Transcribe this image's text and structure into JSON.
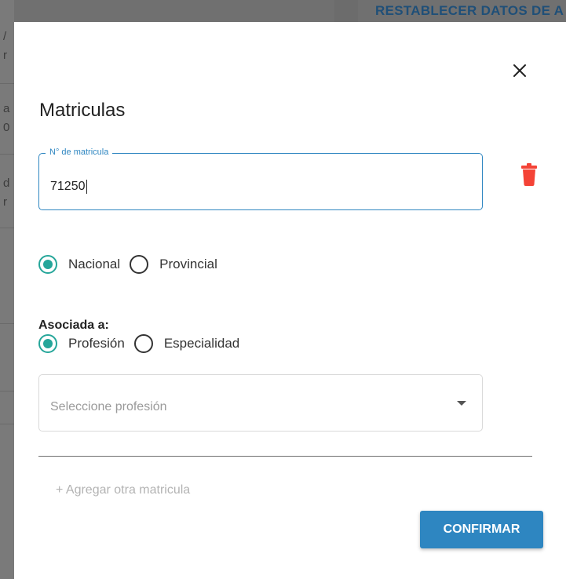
{
  "background": {
    "reset_button_label": "RESTABLECER DATOS DE A",
    "left_chars": [
      "/",
      "r",
      "a",
      "0",
      "d",
      "r"
    ]
  },
  "dialog": {
    "title": "Matriculas",
    "close_icon": "close-icon",
    "matricula_field": {
      "label": "N° de matricula",
      "value": "71250"
    },
    "delete_icon": "trash-icon",
    "delete_color": "#f44336",
    "jurisdiction_options": [
      {
        "label": "Nacional",
        "checked": true
      },
      {
        "label": "Provincial",
        "checked": false
      }
    ],
    "associated_label": "Asociada a:",
    "association_options": [
      {
        "label": "Profesión",
        "checked": true
      },
      {
        "label": "Especialidad",
        "checked": false
      }
    ],
    "select": {
      "placeholder": "Seleccione profesión"
    },
    "add_link": "+ Agregar otra matricula",
    "confirm_label": "CONFIRMAR",
    "colors": {
      "accent": "#2e86c1",
      "radio_checked": "#26a69a"
    }
  }
}
